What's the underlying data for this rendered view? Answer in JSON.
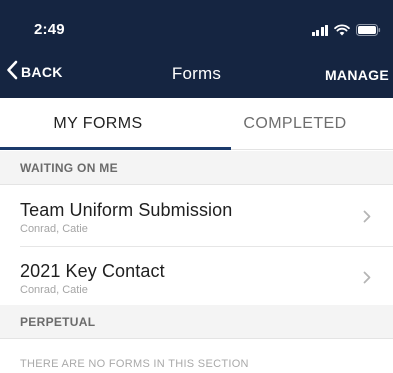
{
  "status_bar": {
    "time": "2:49",
    "icons": [
      "signal-icon",
      "wifi-icon",
      "battery-icon"
    ]
  },
  "nav": {
    "back_label": "BACK",
    "title": "Forms",
    "manage_label": "MANAGE"
  },
  "tabs": [
    {
      "label": "MY FORMS",
      "selected": true
    },
    {
      "label": "COMPLETED",
      "selected": false
    }
  ],
  "sections": [
    {
      "header": "WAITING ON ME",
      "items": [
        {
          "title": "Team Uniform Submission",
          "subtitle": "Conrad, Catie"
        },
        {
          "title": "2021 Key Contact",
          "subtitle": "Conrad, Catie"
        }
      ]
    },
    {
      "header": "PERPETUAL",
      "empty_message": "THERE ARE NO FORMS IN THIS SECTION"
    }
  ],
  "colors": {
    "header_bg": "#152541",
    "tab_indicator": "#1b3a6b",
    "section_bg": "#f4f4f4"
  }
}
